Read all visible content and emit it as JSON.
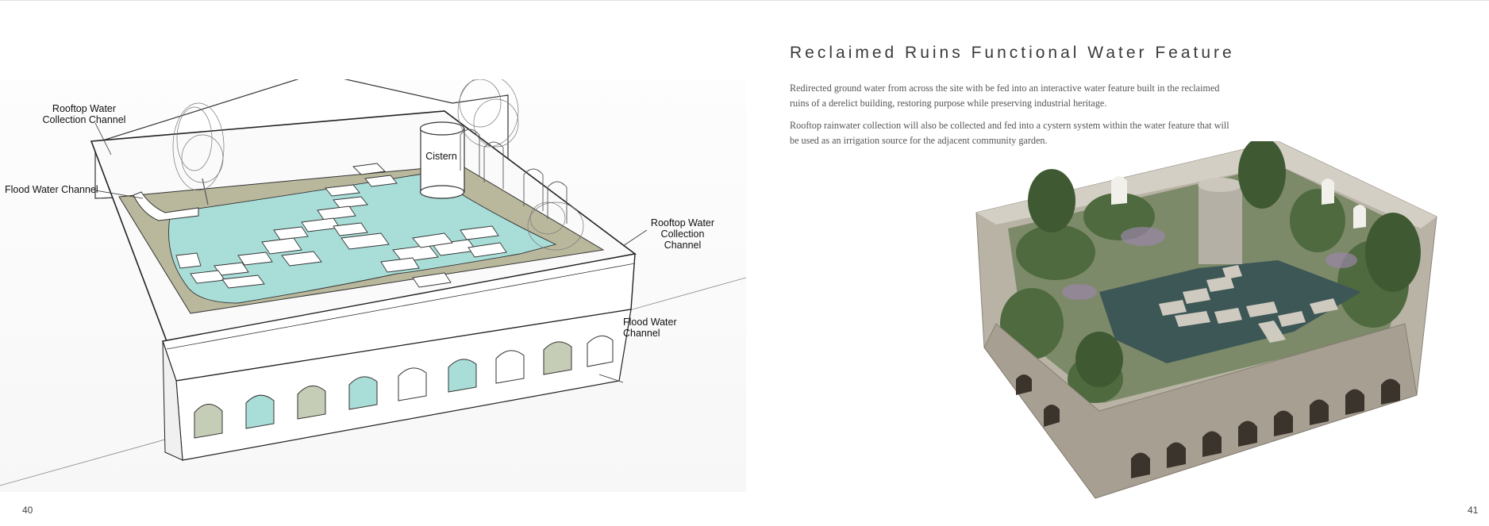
{
  "left_page": {
    "page_number": "40",
    "callouts": {
      "rooftop_top": "Rooftop Water Collection Channel",
      "flood_left": "Flood Water Channel",
      "cistern": "Cistern",
      "rooftop_right": "Rooftop Water Collection Channel",
      "flood_bottom": "Flood Water Channel"
    }
  },
  "right_page": {
    "page_number": "41",
    "title": "Reclaimed Ruins Functional Water Feature",
    "paragraphs": [
      "Redirected ground water from across the site with be fed into an interactive water feature built in the reclaimed ruins of a derelict building, restoring purpose while preserving industrial heritage.",
      "Rooftop rainwater collection will also be collected and fed into a cystern system within the water feature that will be used as an irrigation source for the adjacent community garden."
    ]
  },
  "colors": {
    "water_diagram": "#a9ddd8",
    "ground_diagram": "#b9b89d",
    "water_render": "#3d5756",
    "stone_render": "#b9b3a6"
  }
}
